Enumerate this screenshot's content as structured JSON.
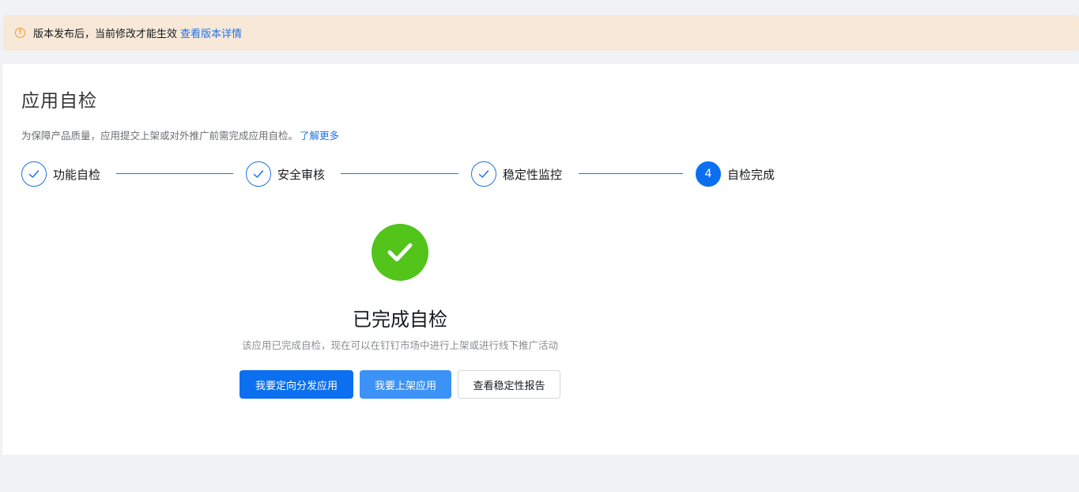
{
  "notice": {
    "icon": "warning-circle-icon",
    "text": "版本发布后，当前修改才能生效",
    "link": "查看版本详情",
    "bg_color": "#f7e8d8"
  },
  "page": {
    "title": "应用自检",
    "description": "为保障产品质量，应用提交上架或对外推广前需完成应用自检。",
    "learn_more": "了解更多"
  },
  "steps": [
    {
      "label": "功能自检",
      "status": "done",
      "icon": "check-icon"
    },
    {
      "label": "安全审核",
      "status": "done",
      "icon": "check-icon"
    },
    {
      "label": "稳定性监控",
      "status": "done",
      "icon": "check-icon"
    },
    {
      "label": "自检完成",
      "status": "active",
      "number": "4"
    }
  ],
  "result": {
    "icon": "success-check-icon",
    "icon_color": "#52c41a",
    "title": "已完成自检",
    "subtitle": "该应用已完成自检，现在可以在钉钉市场中进行上架或进行线下推广活动"
  },
  "actions": {
    "primary": "我要定向分发应用",
    "secondary": "我要上架应用",
    "default": "查看稳定性报告"
  },
  "colors": {
    "accent": "#0b6ff0",
    "link": "#1f73e6",
    "success": "#52c41a"
  }
}
